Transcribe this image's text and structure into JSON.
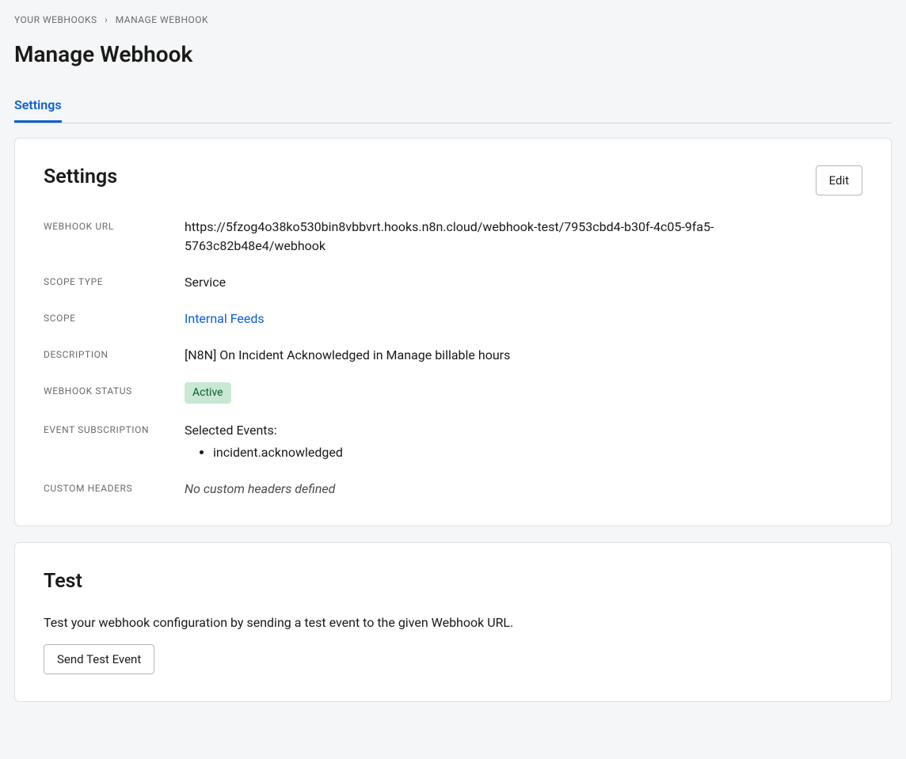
{
  "breadcrumb": {
    "root": "YOUR WEBHOOKS",
    "separator": "›",
    "current": "MANAGE WEBHOOK"
  },
  "page": {
    "title": "Manage Webhook"
  },
  "tabs": {
    "settings": "Settings"
  },
  "settings_card": {
    "heading": "Settings",
    "edit_label": "Edit",
    "fields": {
      "webhook_url": {
        "label": "WEBHOOK URL",
        "value": "https://5fzog4o38ko530bin8vbbvrt.hooks.n8n.cloud/webhook-test/7953cbd4-b30f-4c05-9fa5-5763c82b48e4/webhook"
      },
      "scope_type": {
        "label": "SCOPE TYPE",
        "value": "Service"
      },
      "scope": {
        "label": "SCOPE",
        "value": "Internal Feeds"
      },
      "description": {
        "label": "DESCRIPTION",
        "value": "[N8N] On Incident Acknowledged in Manage billable hours"
      },
      "webhook_status": {
        "label": "WEBHOOK STATUS",
        "value": "Active"
      },
      "event_subscription": {
        "label": "EVENT SUBSCRIPTION",
        "selected_label": "Selected Events:",
        "events": [
          "incident.acknowledged"
        ]
      },
      "custom_headers": {
        "label": "CUSTOM HEADERS",
        "value": "No custom headers defined"
      }
    }
  },
  "test_card": {
    "heading": "Test",
    "description": "Test your webhook configuration by sending a test event to the given Webhook URL.",
    "send_button": "Send Test Event"
  }
}
